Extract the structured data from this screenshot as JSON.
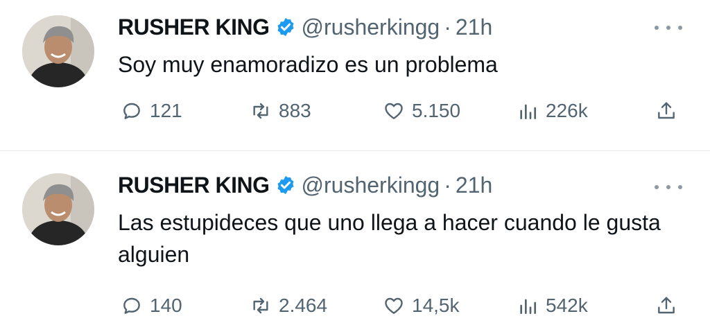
{
  "tweets": [
    {
      "author": {
        "name": "RUSHER KING",
        "handle": "@rusherkingg"
      },
      "separator": "·",
      "time": "21h",
      "text": "Soy muy enamoradizo es un problema",
      "stats": {
        "replies": "121",
        "reposts": "883",
        "likes": "5.150",
        "views": "226k"
      }
    },
    {
      "author": {
        "name": "RUSHER KING",
        "handle": "@rusherkingg"
      },
      "separator": "·",
      "time": "21h",
      "text": "Las estupideces que uno llega a hacer cuando le gusta alguien",
      "stats": {
        "replies": "140",
        "reposts": "2.464",
        "likes": "14,5k",
        "views": "542k"
      }
    }
  ],
  "icons": {
    "verified": "verified-badge-icon",
    "more": "more-horizontal-icon",
    "reply": "reply-icon",
    "repost": "repost-icon",
    "like": "heart-icon",
    "views": "views-chart-icon",
    "share": "share-icon"
  },
  "colors": {
    "verified": "#1d9bf0",
    "secondary_text": "#536471",
    "primary_text": "#0f1419",
    "divider": "#e6e9ec"
  }
}
